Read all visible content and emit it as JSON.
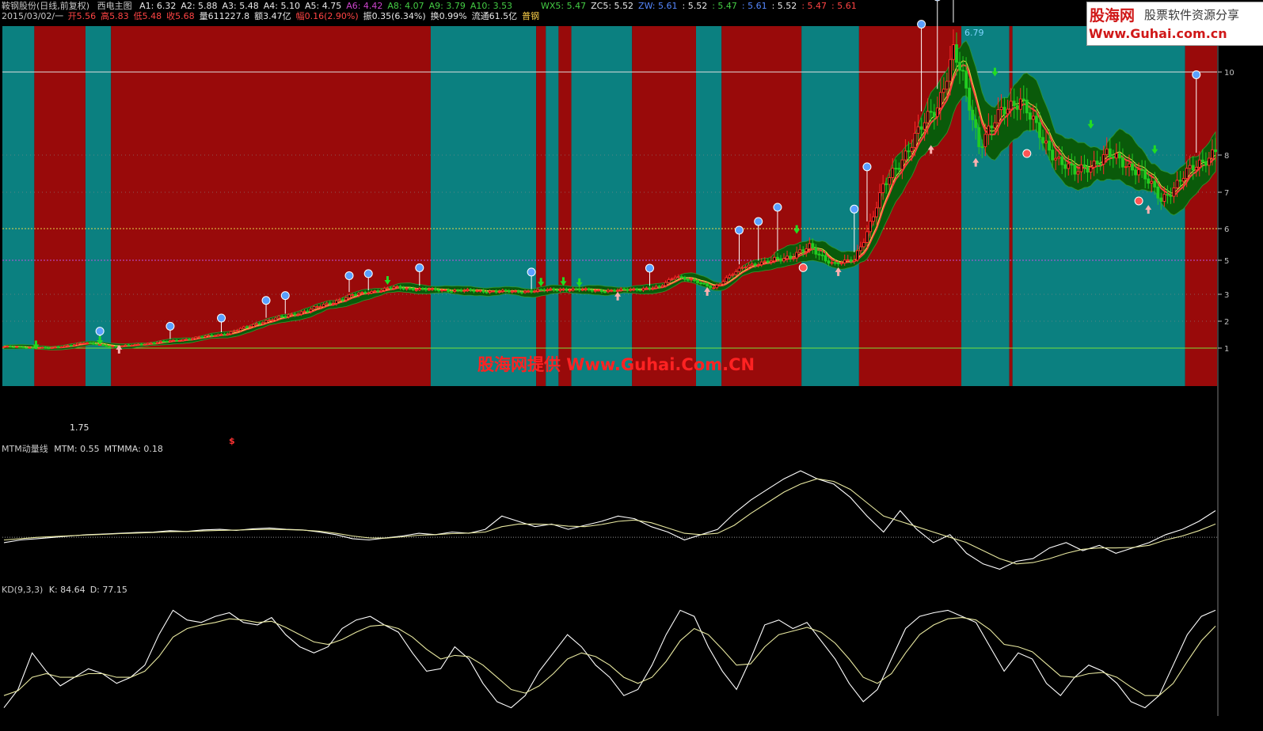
{
  "header": {
    "stock": "鞍钢股份(日线,前复权)",
    "indicator": "西电主图",
    "ma_values": [
      {
        "label": "A1: 6.32",
        "color": "#e8e8e8"
      },
      {
        "label": "A2: 5.88",
        "color": "#e8e8e8"
      },
      {
        "label": "A3: 5.48",
        "color": "#e8e8e8"
      },
      {
        "label": "A4: 5.10",
        "color": "#e8e8e8"
      },
      {
        "label": "A5: 4.75",
        "color": "#e8e8e8"
      },
      {
        "label": "A6: 4.42",
        "color": "#cc44cc"
      },
      {
        "label": "A8: 4.07",
        "color": "#44cc44"
      },
      {
        "label": "A9: 3.79",
        "color": "#44cc44"
      },
      {
        "label": "A10: 3.53",
        "color": "#44cc44"
      }
    ],
    "right_values": [
      {
        "label": "WX5: 5.47",
        "color": "#44cc44"
      },
      {
        "label": "ZC5: 5.52",
        "color": "#e8e8e8"
      },
      {
        "label": "ZW: 5.61",
        "color": "#5588ff"
      },
      {
        "label": ": 5.52",
        "color": "#e8e8e8"
      },
      {
        "label": ": 5.47",
        "color": "#44cc44"
      },
      {
        "label": ": 5.61",
        "color": "#5588ff"
      },
      {
        "label": ": 5.52",
        "color": "#e8e8e8"
      },
      {
        "label": ": 5.47",
        "color": "#ff4444"
      },
      {
        "label": ": 5.61",
        "color": "#ff4444"
      }
    ],
    "date": "2015/03/02/一",
    "quote": [
      {
        "label": "开5.56",
        "color": "#ff4444"
      },
      {
        "label": "高5.83",
        "color": "#ff4444"
      },
      {
        "label": "低5.48",
        "color": "#ff4444"
      },
      {
        "label": "收5.68",
        "color": "#ff4444"
      },
      {
        "label": "量611227.8",
        "color": "#e8e8e8"
      },
      {
        "label": "额3.47亿",
        "color": "#e8e8e8"
      },
      {
        "label": "幅0.16(2.90%)",
        "color": "#ff4444"
      },
      {
        "label": "振0.35(6.34%)",
        "color": "#e8e8e8"
      },
      {
        "label": "换0.99%",
        "color": "#e8e8e8"
      },
      {
        "label": "流通61.5亿",
        "color": "#e8e8e8"
      },
      {
        "label": "普钢",
        "color": "#ffd24a"
      }
    ]
  },
  "logo": {
    "line1": "股海网",
    "line2": "股票软件资源分享",
    "line3": "Www.Guhai.com.cn"
  },
  "watermark": "股海网提供 Www.Guhai.Com.CN",
  "colors": {
    "red_zone": "#990a0a",
    "teal_zone": "#0b8080",
    "band": "#0a5a0a",
    "up": "#ff2a2a",
    "down": "#22cc22",
    "axis": "#c0c0c0"
  },
  "chart_data": [
    {
      "type": "candlestick",
      "title": "西电主图",
      "ylim": [
        0.2,
        11.3
      ],
      "y_ticks": [
        "10",
        "8",
        "7",
        "6",
        "5",
        "3",
        "2",
        "1"
      ],
      "annotations": [
        "6.79",
        "1.75",
        "$"
      ],
      "background_zones": [
        {
          "from_bar": 0,
          "to_bar": 10,
          "zone": "teal"
        },
        {
          "from_bar": 10,
          "to_bar": 26,
          "zone": "red"
        },
        {
          "from_bar": 26,
          "to_bar": 34,
          "zone": "teal"
        },
        {
          "from_bar": 34,
          "to_bar": 134,
          "zone": "red"
        },
        {
          "from_bar": 134,
          "to_bar": 167,
          "zone": "teal"
        },
        {
          "from_bar": 167,
          "to_bar": 170,
          "zone": "red"
        },
        {
          "from_bar": 170,
          "to_bar": 174,
          "zone": "teal"
        },
        {
          "from_bar": 174,
          "to_bar": 178,
          "zone": "red"
        },
        {
          "from_bar": 178,
          "to_bar": 197,
          "zone": "teal"
        },
        {
          "from_bar": 197,
          "to_bar": 217,
          "zone": "red"
        },
        {
          "from_bar": 217,
          "to_bar": 225,
          "zone": "teal"
        },
        {
          "from_bar": 225,
          "to_bar": 250,
          "zone": "red"
        },
        {
          "from_bar": 250,
          "to_bar": 268,
          "zone": "teal"
        },
        {
          "from_bar": 268,
          "to_bar": 300,
          "zone": "red"
        },
        {
          "from_bar": 300,
          "to_bar": 315,
          "zone": "teal"
        },
        {
          "from_bar": 315,
          "to_bar": 316,
          "zone": "red"
        },
        {
          "from_bar": 316,
          "to_bar": 370,
          "zone": "teal"
        },
        {
          "from_bar": 370,
          "to_bar": 380,
          "zone": "red"
        }
      ],
      "close_keyframes": [
        [
          0,
          1.05
        ],
        [
          15,
          1.0
        ],
        [
          25,
          1.2
        ],
        [
          35,
          1.05
        ],
        [
          55,
          1.3
        ],
        [
          70,
          1.55
        ],
        [
          80,
          1.95
        ],
        [
          95,
          2.4
        ],
        [
          110,
          3.0
        ],
        [
          122,
          3.4
        ],
        [
          135,
          3.25
        ],
        [
          160,
          3.15
        ],
        [
          175,
          3.3
        ],
        [
          190,
          3.2
        ],
        [
          205,
          3.4
        ],
        [
          210,
          4.1
        ],
        [
          222,
          3.4
        ],
        [
          232,
          4.7
        ],
        [
          245,
          5.1
        ],
        [
          252,
          5.4
        ],
        [
          260,
          4.8
        ],
        [
          266,
          5.0
        ],
        [
          275,
          7.1
        ],
        [
          283,
          8.2
        ],
        [
          292,
          9.2
        ],
        [
          297,
          10.5
        ],
        [
          300,
          9.8
        ],
        [
          305,
          8.3
        ],
        [
          312,
          9.0
        ],
        [
          318,
          9.4
        ],
        [
          325,
          8.3
        ],
        [
          335,
          7.5
        ],
        [
          345,
          8.0
        ],
        [
          355,
          7.6
        ],
        [
          362,
          6.8
        ],
        [
          370,
          7.5
        ],
        [
          380,
          8.2
        ]
      ],
      "bar_count": 380
    },
    {
      "type": "line",
      "title": "MTM动量线",
      "series": [
        {
          "name": "MTM",
          "last": 0.55,
          "color": "#ffffff",
          "values": [
            -0.2,
            -0.1,
            -0.05,
            0,
            0.05,
            0.1,
            0.12,
            0.15,
            0.18,
            0.2,
            0.25,
            0.22,
            0.28,
            0.3,
            0.26,
            0.32,
            0.35,
            0.3,
            0.28,
            0.2,
            0.1,
            -0.05,
            -0.1,
            -0.02,
            0.05,
            0.15,
            0.1,
            0.2,
            0.15,
            0.3,
            0.8,
            0.6,
            0.4,
            0.5,
            0.3,
            0.45,
            0.6,
            0.8,
            0.7,
            0.4,
            0.2,
            -0.1,
            0.1,
            0.3,
            0.9,
            1.4,
            1.8,
            2.2,
            2.5,
            2.2,
            2.0,
            1.5,
            0.8,
            0.2,
            1.0,
            0.3,
            -0.2,
            0.1,
            -0.6,
            -1.0,
            -1.2,
            -0.9,
            -0.8,
            -0.4,
            -0.2,
            -0.5,
            -0.3,
            -0.6,
            -0.4,
            -0.2,
            0.1,
            0.3,
            0.6,
            1.0
          ]
        },
        {
          "name": "MTMMA",
          "last": 0.18,
          "color": "#e8e8a0",
          "values": [
            -0.1,
            -0.05,
            0,
            0.03,
            0.06,
            0.09,
            0.11,
            0.14,
            0.16,
            0.18,
            0.21,
            0.22,
            0.24,
            0.26,
            0.27,
            0.29,
            0.3,
            0.29,
            0.27,
            0.23,
            0.15,
            0.05,
            -0.02,
            -0.03,
            0.02,
            0.08,
            0.1,
            0.14,
            0.16,
            0.2,
            0.4,
            0.5,
            0.5,
            0.48,
            0.42,
            0.4,
            0.48,
            0.6,
            0.65,
            0.55,
            0.35,
            0.15,
            0.1,
            0.15,
            0.45,
            0.9,
            1.3,
            1.7,
            2.0,
            2.2,
            2.1,
            1.8,
            1.3,
            0.8,
            0.6,
            0.4,
            0.2,
            0.0,
            -0.2,
            -0.5,
            -0.8,
            -1.0,
            -0.95,
            -0.8,
            -0.6,
            -0.45,
            -0.4,
            -0.4,
            -0.38,
            -0.3,
            -0.1,
            0.05,
            0.25,
            0.5
          ]
        }
      ],
      "ylim": [
        -1.6,
        2.8
      ]
    },
    {
      "type": "line",
      "title": "KD(9,3,3)",
      "series": [
        {
          "name": "K",
          "last": 84.64,
          "color": "#ffffff",
          "values": [
            10,
            25,
            55,
            40,
            28,
            35,
            42,
            38,
            30,
            35,
            45,
            70,
            90,
            82,
            80,
            85,
            88,
            80,
            78,
            84,
            70,
            60,
            55,
            60,
            75,
            82,
            85,
            78,
            72,
            55,
            40,
            42,
            60,
            50,
            30,
            15,
            10,
            20,
            40,
            55,
            70,
            60,
            45,
            35,
            20,
            25,
            45,
            70,
            90,
            85,
            60,
            40,
            25,
            50,
            78,
            82,
            75,
            80,
            65,
            50,
            30,
            15,
            25,
            50,
            75,
            85,
            88,
            90,
            85,
            80,
            60,
            40,
            55,
            50,
            30,
            20,
            35,
            45,
            40,
            30,
            15,
            10,
            20,
            45,
            70,
            85,
            90
          ]
        },
        {
          "name": "D",
          "last": 77.15,
          "color": "#e8e8a0",
          "values": [
            20,
            24,
            35,
            38,
            35,
            35,
            38,
            38,
            35,
            35,
            40,
            52,
            68,
            75,
            78,
            80,
            83,
            82,
            80,
            81,
            76,
            70,
            64,
            62,
            66,
            72,
            77,
            78,
            75,
            68,
            58,
            50,
            53,
            52,
            45,
            35,
            25,
            22,
            28,
            38,
            50,
            55,
            52,
            45,
            35,
            30,
            35,
            48,
            65,
            75,
            70,
            58,
            45,
            46,
            60,
            70,
            73,
            76,
            72,
            63,
            50,
            35,
            30,
            38,
            55,
            70,
            78,
            83,
            84,
            82,
            74,
            62,
            60,
            56,
            46,
            36,
            35,
            38,
            39,
            35,
            27,
            20,
            20,
            30,
            48,
            65,
            77
          ]
        }
      ],
      "ylim": [
        0,
        100
      ]
    }
  ]
}
